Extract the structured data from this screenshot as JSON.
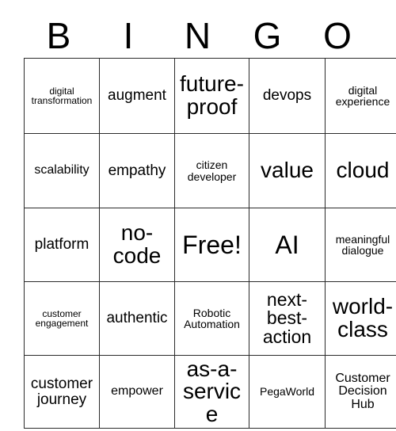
{
  "card": {
    "title": "BINGO",
    "header_letters": [
      "B",
      "I",
      "N",
      "G",
      "O"
    ],
    "columns": 5,
    "rows": 5,
    "free_space": "Free!",
    "grid_line_color": "#2b2b2b",
    "background_color": "#ffffff",
    "text_color": "#000000"
  },
  "cells": [
    [
      {
        "text": "digital transformation",
        "size": "fs-xs"
      },
      {
        "text": "augment",
        "size": "fs-l"
      },
      {
        "text": "future-proof",
        "size": "fs-xxl"
      },
      {
        "text": "devops",
        "size": "fs-l"
      },
      {
        "text": "digital experience",
        "size": "fs-s"
      }
    ],
    [
      {
        "text": "scalability",
        "size": "fs-m"
      },
      {
        "text": "empathy",
        "size": "fs-l"
      },
      {
        "text": "citizen developer",
        "size": "fs-s"
      },
      {
        "text": "value",
        "size": "fs-xxl"
      },
      {
        "text": "cloud",
        "size": "fs-xxl"
      }
    ],
    [
      {
        "text": "platform",
        "size": "fs-l"
      },
      {
        "text": "no-code",
        "size": "fs-xxl"
      },
      {
        "text": "Free!",
        "size": "fs-3xl"
      },
      {
        "text": "AI",
        "size": "fs-3xl"
      },
      {
        "text": "meaningful dialogue",
        "size": "fs-s"
      }
    ],
    [
      {
        "text": "customer engagement",
        "size": "fs-xs"
      },
      {
        "text": "authentic",
        "size": "fs-l"
      },
      {
        "text": "Robotic Automation",
        "size": "fs-s"
      },
      {
        "text": "next-best-action",
        "size": "fs-xl"
      },
      {
        "text": "world-class",
        "size": "fs-xxl"
      }
    ],
    [
      {
        "text": "customer journey",
        "size": "fs-l"
      },
      {
        "text": "empower",
        "size": "fs-m"
      },
      {
        "text": "as-a-service",
        "size": "fs-xxl"
      },
      {
        "text": "PegaWorld",
        "size": "fs-s"
      },
      {
        "text": "Customer Decision Hub",
        "size": "fs-m"
      }
    ]
  ]
}
